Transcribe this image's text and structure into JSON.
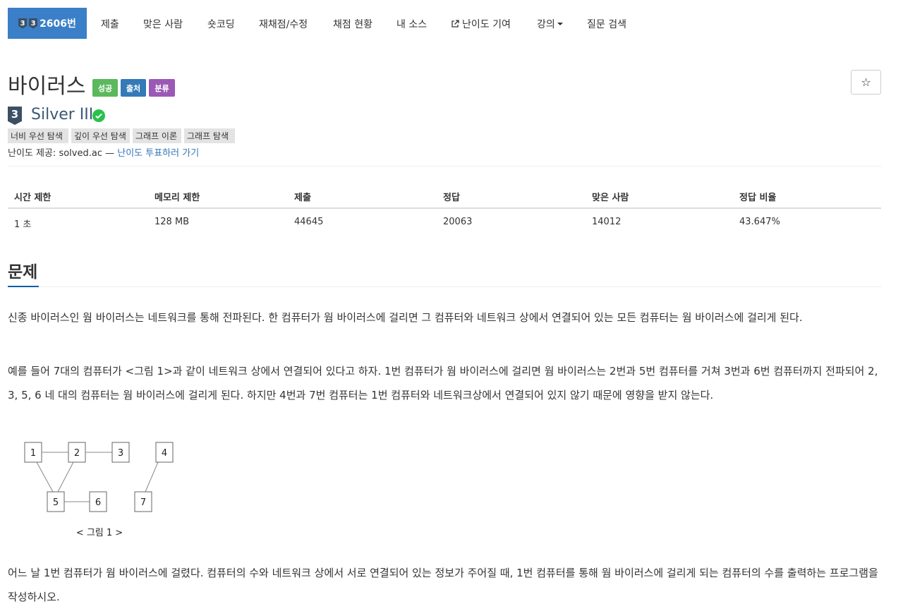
{
  "nav": {
    "active": {
      "badge1": "3",
      "badge2": "3",
      "label": "2606번"
    },
    "items": [
      "제출",
      "맞은 사람",
      "숏코딩",
      "재채점/수정",
      "채점 현황",
      "내 소스",
      "난이도 기여",
      "강의",
      "질문 검색"
    ]
  },
  "problem": {
    "title": "바이러스",
    "labels": [
      {
        "text": "성공",
        "color": "#5cb85c"
      },
      {
        "text": "출처",
        "color": "#337ab7"
      },
      {
        "text": "분류",
        "color": "#9b59b6"
      }
    ],
    "star": "☆",
    "tier": {
      "badge": "3",
      "name": "Silver III",
      "color": "#3c4f64"
    },
    "tags": [
      "너비 우선 탐색",
      "깊이 우선 탐색",
      "그래프 이론",
      "그래프 탐색"
    ],
    "provider": {
      "prefix": "난이도 제공: solved.ac — ",
      "link": "난이도 투표하러 가기"
    }
  },
  "stats": {
    "headers": [
      "시간 제한",
      "메모리 제한",
      "제출",
      "정답",
      "맞은 사람",
      "정답 비율"
    ],
    "values": [
      "1 초",
      "128 MB",
      "44645",
      "20063",
      "14012",
      "43.647%"
    ]
  },
  "section": {
    "title": "문제",
    "paragraphs": [
      "신종 바이러스인 웜 바이러스는 네트워크를 통해 전파된다. 한 컴퓨터가 웜 바이러스에 걸리면 그 컴퓨터와 네트워크 상에서 연결되어 있는 모든 컴퓨터는 웜 바이러스에 걸리게 된다.",
      "예를 들어 7대의 컴퓨터가 <그림 1>과 같이 네트워크 상에서 연결되어 있다고 하자. 1번 컴퓨터가 웜 바이러스에 걸리면 웜 바이러스는 2번과 5번 컴퓨터를 거쳐 3번과 6번 컴퓨터까지 전파되어 2, 3, 5, 6 네 대의 컴퓨터는 웜 바이러스에 걸리게 된다. 하지만 4번과 7번 컴퓨터는 1번 컴퓨터와 네트워크상에서 연결되어 있지 않기 때문에 영향을 받지 않는다.",
      "어느 날 1번 컴퓨터가 웜 바이러스에 걸렸다. 컴퓨터의 수와 네트워크 상에서 서로 연결되어 있는 정보가 주어질 때, 1번 컴퓨터를 통해 웜 바이러스에 걸리게 되는 컴퓨터의 수를 출력하는 프로그램을 작성하시오."
    ],
    "figure": {
      "nodes": [
        "1",
        "2",
        "3",
        "4",
        "5",
        "6",
        "7"
      ],
      "caption": "< 그림 1 >"
    }
  }
}
